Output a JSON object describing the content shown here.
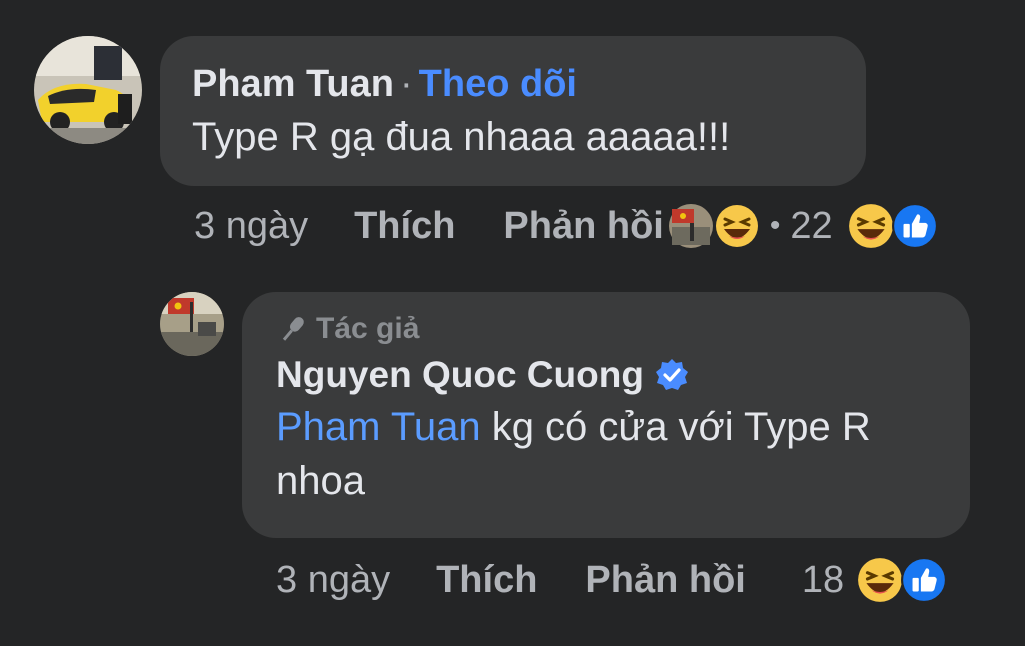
{
  "comment": {
    "author": "Pham Tuan",
    "follow_label": "Theo dõi",
    "separator": "·",
    "text": "Type R gạ đua nhaaa aaaaa!!!",
    "time": "3 ngày",
    "like_label": "Thích",
    "reply_label": "Phản hồi",
    "reaction_separator": "•",
    "reaction_count": "22",
    "reactions": [
      "haha-icon",
      "like-icon"
    ]
  },
  "reply": {
    "author_tag": "Tác giả",
    "author": "Nguyen Quoc Cuong",
    "verified": "verified-badge-icon",
    "mention": "Pham Tuan",
    "text": " kg có cửa với Type R nhoa",
    "time": "3 ngày",
    "like_label": "Thích",
    "reply_label": "Phản hồi",
    "reaction_count": "18",
    "reactions": [
      "haha-icon",
      "like-icon"
    ]
  },
  "colors": {
    "background": "#242526",
    "bubble": "#3a3b3c",
    "primary_text": "#e4e6eb",
    "secondary_text": "#b0b3b8",
    "link_blue": "#4a8cff",
    "like_blue": "#1877f2",
    "haha_yellow": "#f7c84a"
  }
}
